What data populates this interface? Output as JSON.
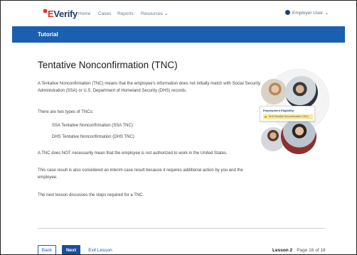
{
  "brand": {
    "logo_prefix": "E",
    "logo_text": "Verify"
  },
  "nav": {
    "items": [
      {
        "label": "Home"
      },
      {
        "label": "Cases"
      },
      {
        "label": "Reports"
      },
      {
        "label": "Resources"
      }
    ],
    "resources_chevron": "❯",
    "user_label": "Employer User"
  },
  "banner": {
    "title": "Tutorial"
  },
  "content": {
    "title": "Tentative Nonconfirmation (TNC)",
    "para1": "A Tentative Nonconfirmation (TNC) means that the employee's information does not initially match with Social Security Administration (SSA) or U.S. Department of Homeland Security (DHS) records.",
    "para2": "There are two types of TNCs:",
    "tnc_types": [
      "SSA Tentative Nonconfirmation (SSA TNC)",
      "DHS Tentative Nonconfirmation (DHS TNC)"
    ],
    "para3": "A TNC does NOT necessarily mean that the employee is not authorized to work in the United States.",
    "para4": "This case result is also considered an interim case result because it requires additional action by you and the employee.",
    "para5": "The next lesson discusses the steps required for a TNC."
  },
  "illustration": {
    "card_title": "Employment Eligibility:",
    "card_status": "DHS Tentative Nonconfirmation (TNC)"
  },
  "footer": {
    "back_label": "Back",
    "next_label": "Next",
    "exit_label": "Exit Lesson",
    "lesson_label": "Lesson 2",
    "page_label": "Page 16 of 18"
  },
  "colors": {
    "brand_blue": "#1a5fb0",
    "navy": "#1c3f73",
    "logo_red": "#e0312b",
    "status_yellow": "#f7e99a"
  }
}
